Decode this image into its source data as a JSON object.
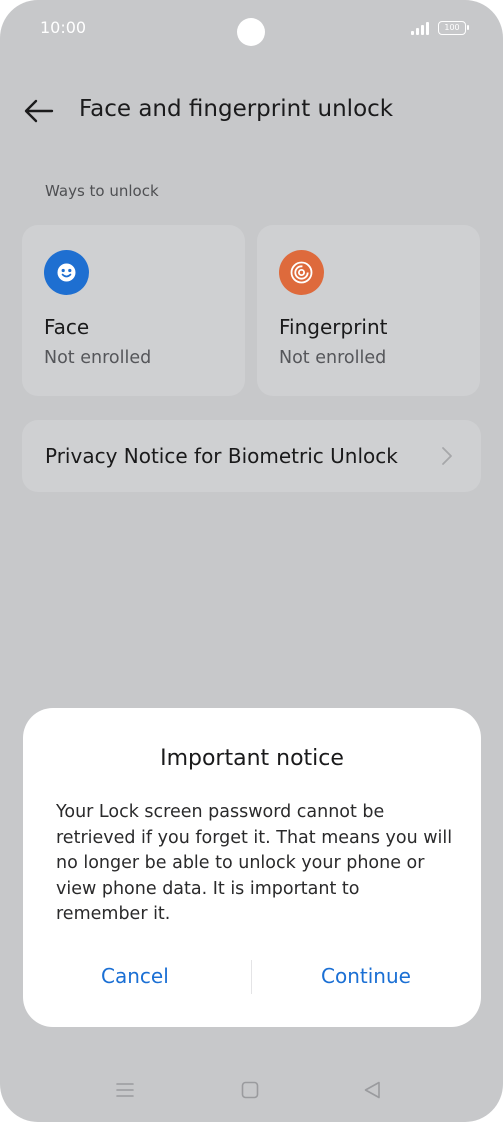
{
  "status_bar": {
    "time": "10:00",
    "battery": "100",
    "icons": [
      "camera-cutout",
      "signal-icon",
      "battery-icon"
    ]
  },
  "header": {
    "back_icon": "arrow-left-icon",
    "title": "Face and fingerprint unlock"
  },
  "section": {
    "label": "Ways to unlock"
  },
  "methods": [
    {
      "name": "Face",
      "status": "Not enrolled",
      "icon": "face-icon",
      "icon_color": "#1e6fd1"
    },
    {
      "name": "Fingerprint",
      "status": "Not enrolled",
      "icon": "fingerprint-icon",
      "icon_color": "#de6a3c"
    }
  ],
  "privacy_row": {
    "label": "Privacy Notice for Biometric Unlock",
    "icon": "chevron-right-icon"
  },
  "dialog": {
    "title": "Important notice",
    "message": "Your Lock screen password cannot be retrieved if you forget it. That means you will no longer be able to unlock your phone or view phone data. It is important to remember it.",
    "cancel_label": "Cancel",
    "continue_label": "Continue",
    "accent": "#1a6fd4"
  },
  "nav_bar": {
    "icons": [
      "menu-icon",
      "home-icon",
      "back-icon"
    ]
  },
  "colors": {
    "background_dimmed": "#c7c8ca",
    "card": "#cfd0d2",
    "sheet": "#ffffff"
  }
}
